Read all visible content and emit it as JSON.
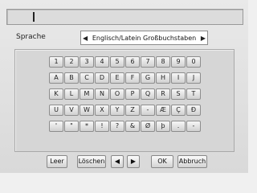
{
  "input": {
    "value": ""
  },
  "language": {
    "label": "Sprache",
    "value": "Englisch/Latein Großbuchstaben",
    "left_arrow": "◀",
    "right_arrow": "▶"
  },
  "keyboard": {
    "rows": [
      [
        "1",
        "2",
        "3",
        "4",
        "5",
        "6",
        "7",
        "8",
        "9",
        "0"
      ],
      [
        "A",
        "B",
        "C",
        "D",
        "E",
        "F",
        "G",
        "H",
        "I",
        "J"
      ],
      [
        "K",
        "L",
        "M",
        "N",
        "O",
        "P",
        "Q",
        "R",
        "S",
        "T"
      ],
      [
        "U",
        "V",
        "W",
        "X",
        "Y",
        "Z",
        "-",
        "Æ",
        "Ç",
        "Ð"
      ],
      [
        "'",
        "\"",
        "*",
        "!",
        "?",
        "&",
        "Ø",
        "þ",
        ".",
        "-"
      ]
    ]
  },
  "buttons": {
    "space": "Leer",
    "delete": "Löschen",
    "left": "◀",
    "right": "▶",
    "ok": "OK",
    "cancel": "Abbruch"
  }
}
